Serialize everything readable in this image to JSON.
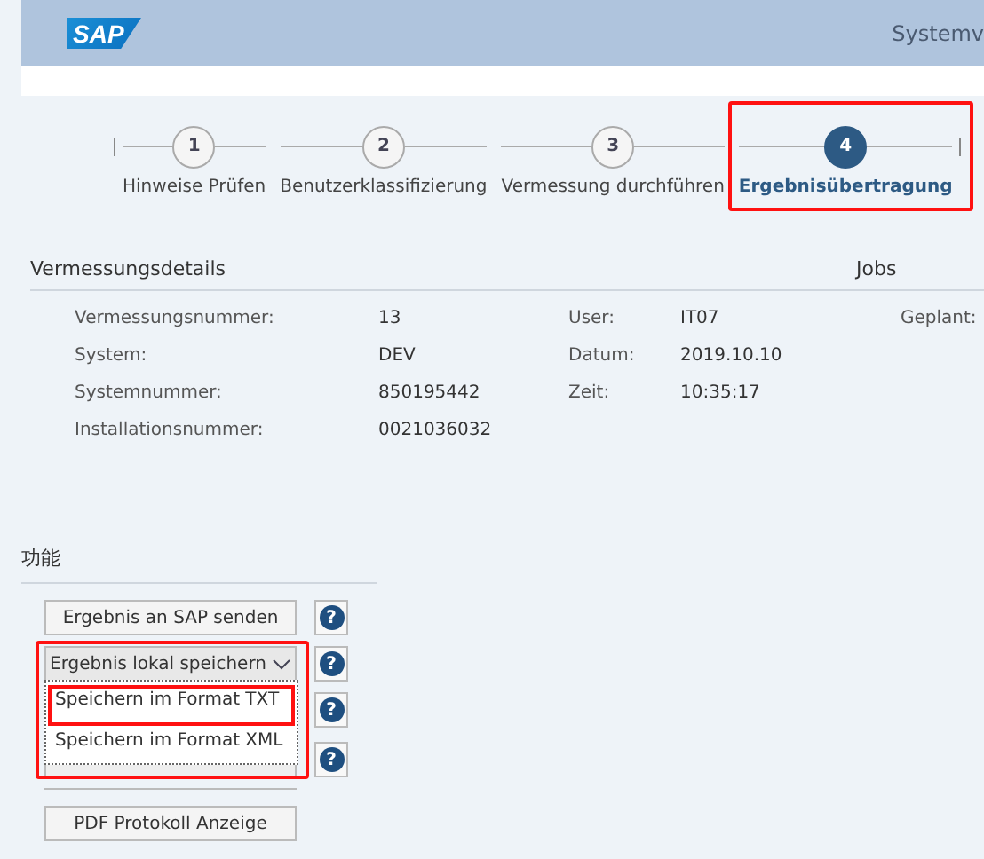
{
  "header": {
    "logo": "SAP",
    "title": "Systemv"
  },
  "steps": [
    {
      "number": "1",
      "label": "Hinweise Prüfen",
      "selected": false
    },
    {
      "number": "2",
      "label": "Benutzerklassifizierung",
      "selected": false
    },
    {
      "number": "3",
      "label": "Vermessung durchführen",
      "selected": false
    },
    {
      "number": "4",
      "label": "Ergebnisübertragung",
      "selected": true
    }
  ],
  "details": {
    "title": "Vermessungsdetails",
    "jobs_title": "Jobs",
    "rows": [
      {
        "label": "Vermessungsnummer:",
        "value": "13",
        "label_2": "User:",
        "value_2": "IT07",
        "label_3": "Geplant:"
      },
      {
        "label": "System:",
        "value": "DEV",
        "label_2": "Datum:",
        "value_2": "2019.10.10"
      },
      {
        "label": "Systemnummer:",
        "value": "850195442",
        "label_2": "Zeit:",
        "value_2": "10:35:17"
      },
      {
        "label": "Installationsnummer:",
        "value": "0021036032"
      }
    ]
  },
  "functions": {
    "title": "功能",
    "buttons": [
      {
        "kind": "button",
        "label": "Ergebnis an SAP senden",
        "help": "?"
      },
      {
        "kind": "dropdown",
        "label": "Ergebnis lokal speichern",
        "help": "?"
      },
      {
        "kind": "covered",
        "help": "?"
      },
      {
        "kind": "hidden",
        "help": "?"
      }
    ],
    "menu": [
      {
        "label": "Speichern im Format TXT",
        "selected": true
      },
      {
        "label": "Speichern im Format XML",
        "selected": false
      }
    ],
    "pdf_button": "PDF Protokoll Anzeige"
  }
}
